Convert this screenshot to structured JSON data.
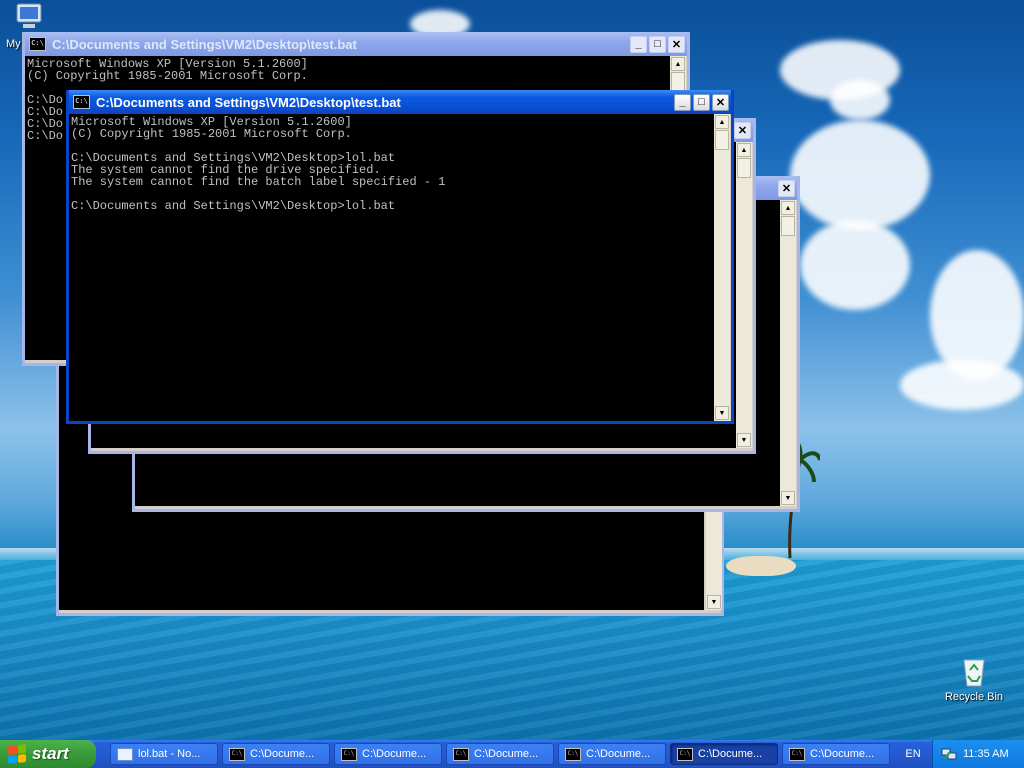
{
  "desktop": {
    "icons": [
      {
        "label": "My"
      },
      {
        "label": "Recycle Bin"
      }
    ]
  },
  "windows": {
    "back": {
      "title": "C:\\Documents and Settings\\VM2\\Desktop\\test.bat",
      "console_text": "Microsoft Windows XP [Version 5.1.2600]\n(C) Copyright 1985-2001 Microsoft Corp.\n\nC:\\Do\nC:\\Do\nC:\\Do\nC:\\Do"
    },
    "front": {
      "title": "C:\\Documents and Settings\\VM2\\Desktop\\test.bat",
      "console_text": "Microsoft Windows XP [Version 5.1.2600]\n(C) Copyright 1985-2001 Microsoft Corp.\n\nC:\\Documents and Settings\\VM2\\Desktop>lol.bat\nThe system cannot find the drive specified.\nThe system cannot find the batch label specified - 1\n\nC:\\Documents and Settings\\VM2\\Desktop>lol.bat"
    },
    "controls": {
      "minimize": "_",
      "maximize": "□",
      "close": "✕"
    },
    "cmd_icon": "C:\\",
    "scroll_up": "▲",
    "scroll_down": "▼"
  },
  "taskbar": {
    "start_label": "start",
    "tasks": [
      {
        "label": "lol.bat - No...",
        "icon": "notepad-icon"
      },
      {
        "label": "C:\\Docume...",
        "icon": "cmd-icon"
      },
      {
        "label": "C:\\Docume...",
        "icon": "cmd-icon"
      },
      {
        "label": "C:\\Docume...",
        "icon": "cmd-icon"
      },
      {
        "label": "C:\\Docume...",
        "icon": "cmd-icon"
      },
      {
        "label": "C:\\Docume...",
        "icon": "cmd-icon",
        "active": true
      },
      {
        "label": "C:\\Docume...",
        "icon": "cmd-icon"
      }
    ],
    "language": "EN",
    "clock": "11:35 AM"
  },
  "colors": {
    "title_active": "#0a5be0",
    "title_inactive": "#8fa8ec",
    "console_bg": "#000000",
    "console_fg": "#c0c0c0",
    "start_green": "#3a9a3a"
  }
}
